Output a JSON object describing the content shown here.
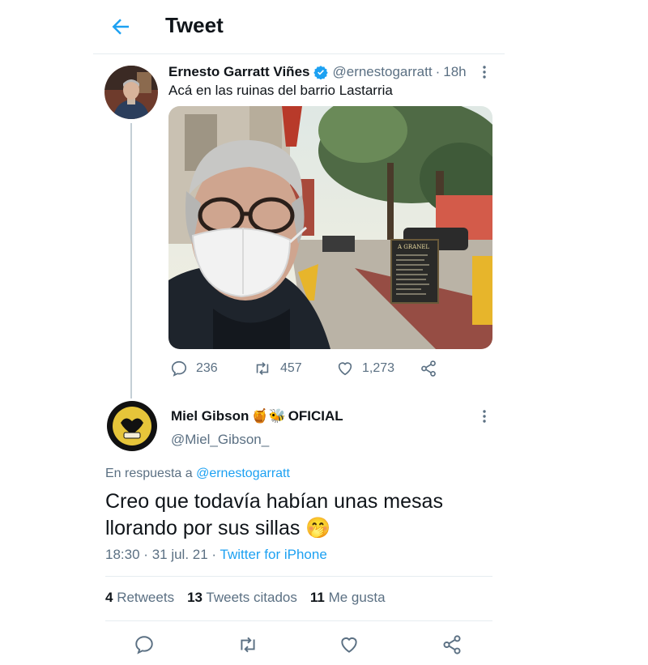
{
  "header": {
    "title": "Tweet",
    "back_icon": "arrow-left-icon"
  },
  "colors": {
    "accent": "#1da1f2",
    "muted": "#5b7083",
    "text": "#0f1419",
    "divider": "#e6ecf0"
  },
  "parent_tweet": {
    "name": "Ernesto Garratt Viñes",
    "handle": "@ernestogarratt",
    "dot": "·",
    "time": "18h",
    "text": "Acá en las ruinas del barrio Lastarria",
    "photo_sign_text": "A GRANEL",
    "actions": {
      "replies": "236",
      "retweets": "457",
      "likes": "1,273"
    }
  },
  "reply_tweet": {
    "name": "Miel Gibson",
    "name_emojis": "🍯🐝",
    "name_suffix": "OFICIAL",
    "handle": "@Miel_Gibson_",
    "in_reply_prefix": "En respuesta a",
    "in_reply_handle": "@ernestogarratt",
    "text_line1": "Creo que todavía habían unas mesas",
    "text_line2": "llorando por sus sillas",
    "text_emoji": "🤭",
    "time": "18:30",
    "dot": "·",
    "date": "31 jul. 21",
    "dot2": "·",
    "client": "Twitter for iPhone",
    "stats": {
      "retweets_count": "4",
      "retweets_label": "Retweets",
      "quotes_count": "13",
      "quotes_label": "Tweets citados",
      "likes_count": "11",
      "likes_label": "Me gusta"
    }
  }
}
